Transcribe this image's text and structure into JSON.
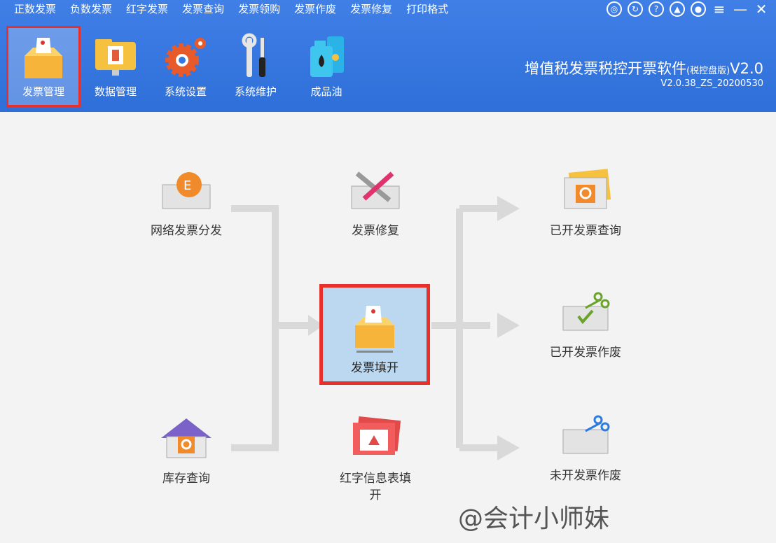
{
  "menu": [
    "正数发票",
    "负数发票",
    "红字发票",
    "发票查询",
    "发票领购",
    "发票作废",
    "发票修复",
    "打印格式"
  ],
  "toolbar": [
    {
      "label": "发票管理",
      "active": true,
      "icon": "invoice-box-icon"
    },
    {
      "label": "数据管理",
      "active": false,
      "icon": "folder-monitor-icon"
    },
    {
      "label": "系统设置",
      "active": false,
      "icon": "gear-icon"
    },
    {
      "label": "系统维护",
      "active": false,
      "icon": "wrench-screwdriver-icon"
    },
    {
      "label": "成品油",
      "active": false,
      "icon": "oil-barrel-icon"
    }
  ],
  "title": {
    "name": "增值税发票税控开票软件",
    "edition": "(税控盘版)",
    "version": "V2.0",
    "build": "V2.0.38_ZS_20200530"
  },
  "flow": {
    "left": [
      "网络发票分发",
      "库存查询"
    ],
    "middle_top": "发票修复",
    "center": "发票填开",
    "middle_bottom": "红字信息表填开",
    "right": [
      "已开发票查询",
      "已开发票作废",
      "未开发票作废"
    ]
  },
  "watermark": "@会计小师妹",
  "colors": {
    "topbar": "#3278e0",
    "highlight": "#e8302a",
    "center_bg": "#bcd8f1"
  }
}
